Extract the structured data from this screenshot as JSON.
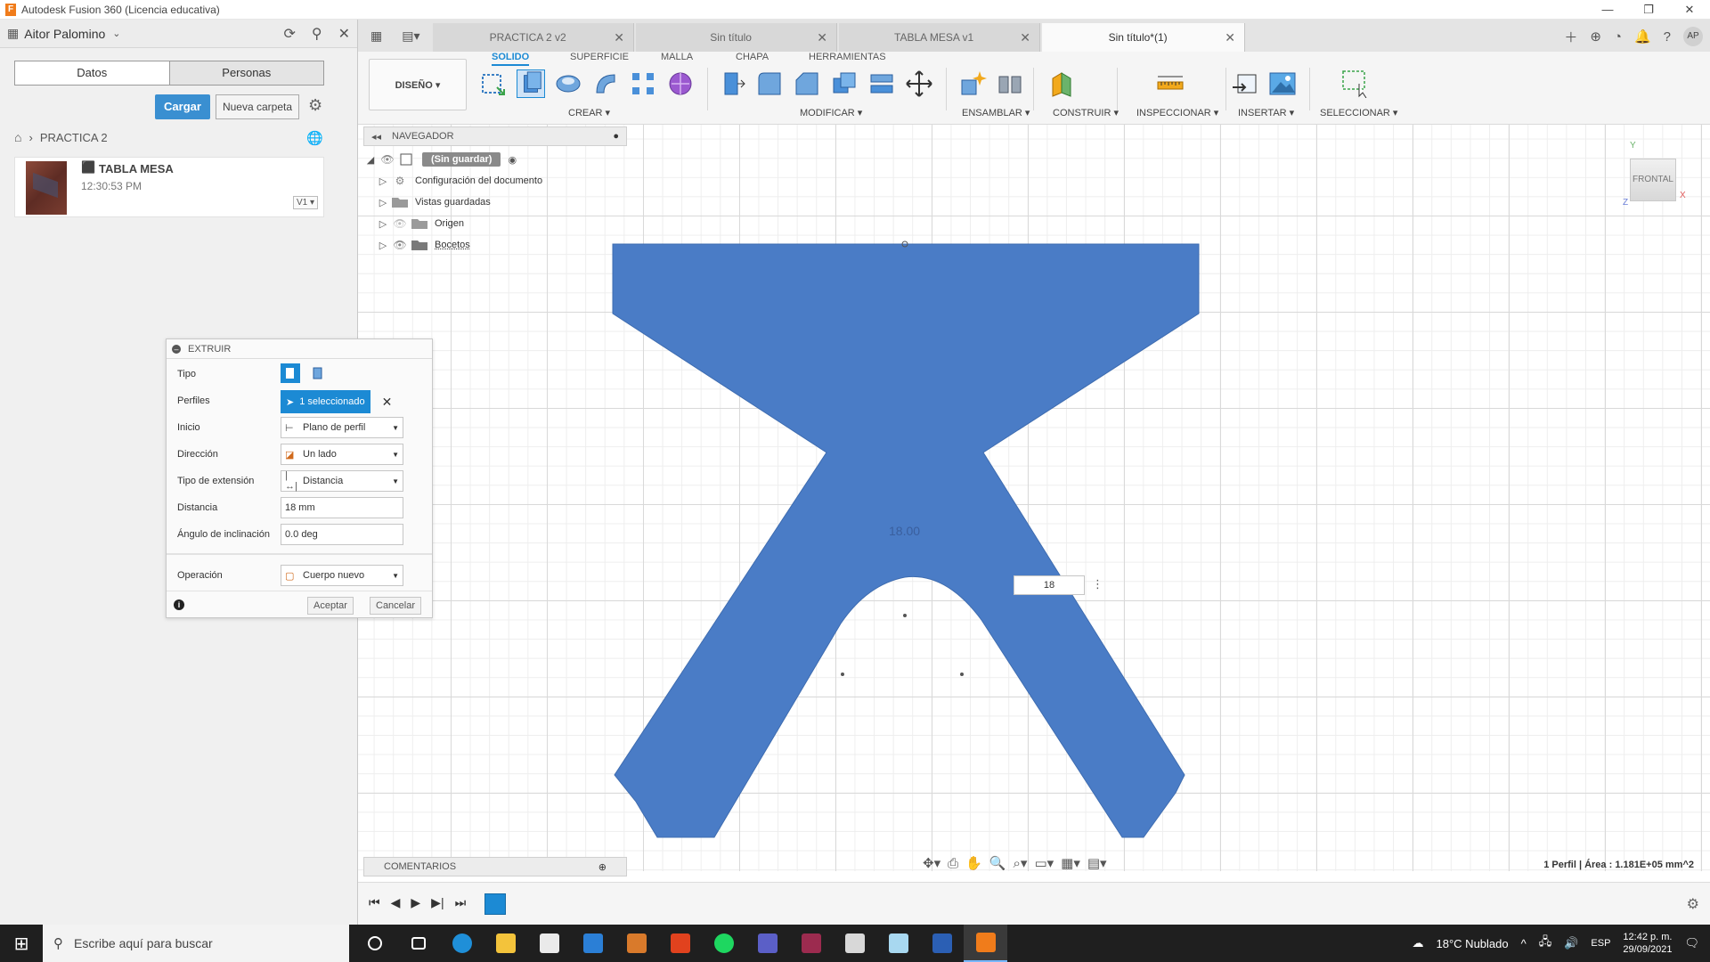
{
  "window": {
    "title": "Autodesk Fusion 360 (Licencia educativa)",
    "controls": [
      "—",
      "❐",
      "✕"
    ]
  },
  "datapanel": {
    "username": "Aitor Palomino",
    "tabs": [
      "Datos",
      "Personas"
    ],
    "upload_label": "Cargar",
    "new_folder_label": "Nueva carpeta",
    "breadcrumb": "PRACTICA 2",
    "file": {
      "name": "TABLA MESA",
      "time": "12:30:53 PM",
      "version": "V1 ▾"
    }
  },
  "tabs": [
    {
      "label": "PRACTICA 2 v2",
      "active": false
    },
    {
      "label": "Sin título",
      "active": false
    },
    {
      "label": "TABLA MESA v1",
      "active": false
    },
    {
      "label": "Sin título*(1)",
      "active": true
    }
  ],
  "user_initials": "AP",
  "toolbar": {
    "workspace": "DISEÑO ▾",
    "tabs": [
      "SOLIDO",
      "SUPERFICIE",
      "MALLA",
      "CHAPA",
      "HERRAMIENTAS"
    ],
    "groups": [
      "CREAR ▾",
      "MODIFICAR ▾",
      "ENSAMBLAR ▾",
      "CONSTRUIR ▾",
      "INSPECCIONAR ▾",
      "INSERTAR ▾",
      "SELECCIONAR ▾"
    ]
  },
  "navigator": {
    "title": "NAVEGADOR",
    "root": "(Sin guardar)",
    "items": [
      "Configuración del documento",
      "Vistas guardadas",
      "Origen",
      "Bocetos"
    ]
  },
  "extrude": {
    "title": "EXTRUIR",
    "rows": {
      "tipo": "Tipo",
      "perfiles": "Perfiles",
      "perfiles_value": "1 seleccionado",
      "inicio": "Inicio",
      "inicio_value": "Plano de perfil",
      "direccion": "Dirección",
      "direccion_value": "Un lado",
      "extension": "Tipo de extensión",
      "extension_value": "Distancia",
      "distancia": "Distancia",
      "distancia_value": "18 mm",
      "angulo": "Ángulo de inclinación",
      "angulo_value": "0.0 deg",
      "operacion": "Operación",
      "operacion_value": "Cuerpo nuevo"
    },
    "accept_label": "Aceptar",
    "cancel_label": "Cancelar"
  },
  "canvas": {
    "dimension_label": "18.00",
    "dimension_input": "18",
    "viewcube_label": "FRONTAL",
    "shape_color": "#4a7cc6"
  },
  "comments_label": "COMENTARIOS",
  "status_text": "1 Perfil | Área : 1.181E+05 mm^2",
  "taskbar": {
    "search_placeholder": "Escribe aquí para buscar",
    "weather": "18°C  Nublado",
    "lang": "ESP",
    "time": "12:42 p. m.",
    "date": "29/09/2021"
  }
}
